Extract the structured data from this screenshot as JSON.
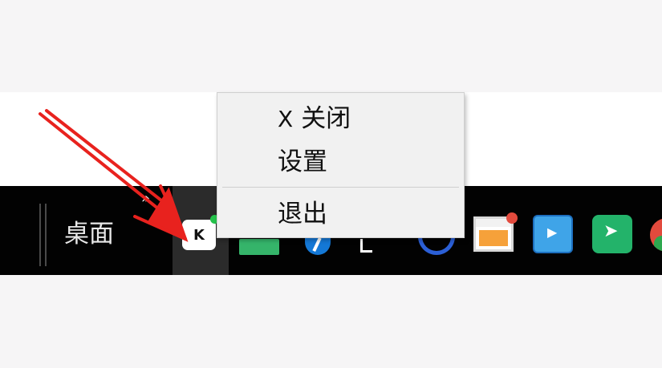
{
  "taskbar": {
    "desktop_label": "桌面",
    "overflow_glyph": "»",
    "active_app_letter": "K",
    "tray_icons": [
      "green-app-icon",
      "blue-circle-app-icon",
      "bracket-icon",
      "ring-app-icon",
      "browser-window-icon",
      "video-app-icon",
      "share-app-icon",
      "chrome-icon"
    ]
  },
  "context_menu": {
    "items": [
      {
        "label": "关闭",
        "icon": "close-icon",
        "glyph": "X"
      },
      {
        "label": "设置"
      },
      {
        "label": "退出"
      }
    ]
  },
  "annotation": {
    "color": "#e8221e",
    "icon": "red-arrow-annotation"
  }
}
